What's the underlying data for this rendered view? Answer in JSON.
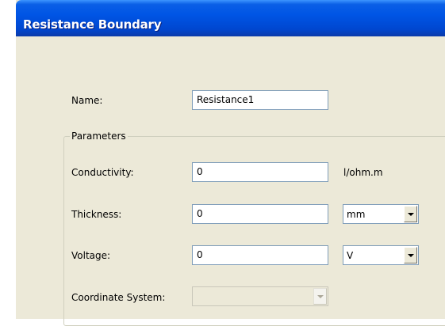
{
  "window": {
    "title": "Resistance Boundary"
  },
  "form": {
    "name_label": "Name:",
    "name_value": "Resistance1"
  },
  "parameters": {
    "group_title": "Parameters",
    "conductivity": {
      "label": "Conductivity:",
      "value": "0",
      "unit": "l/ohm.m"
    },
    "thickness": {
      "label": "Thickness:",
      "value": "0",
      "unit": "mm"
    },
    "voltage": {
      "label": "Voltage:",
      "value": "0",
      "unit": "V"
    },
    "coordinate_system": {
      "label": "Coordinate System:",
      "value": "",
      "enabled": false
    }
  }
}
